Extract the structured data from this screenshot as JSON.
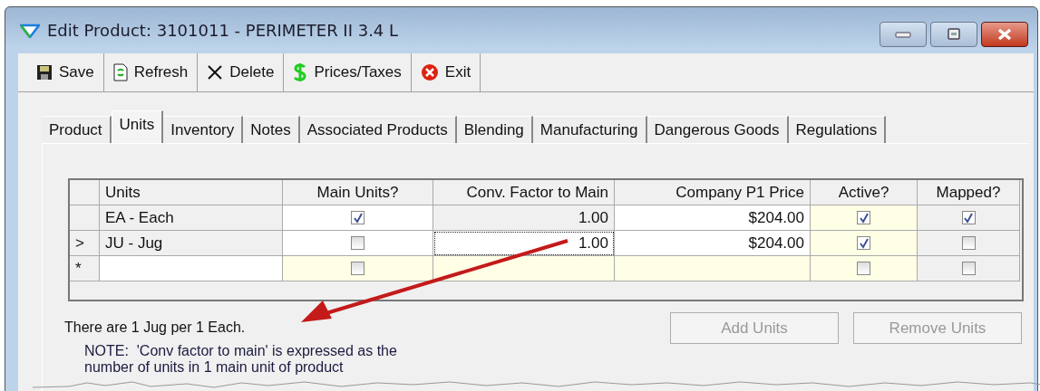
{
  "window": {
    "title": "Edit Product: 3101011 - PERIMETER II 3.4 L"
  },
  "toolbar": [
    {
      "kind": "save",
      "label": "Save"
    },
    {
      "kind": "refresh",
      "label": "Refresh"
    },
    {
      "kind": "delete",
      "label": "Delete"
    },
    {
      "kind": "prices",
      "label": "Prices/Taxes"
    },
    {
      "kind": "exit",
      "label": "Exit"
    }
  ],
  "tabs": [
    {
      "label": "Product",
      "selected": false
    },
    {
      "label": "Units",
      "selected": true
    },
    {
      "label": "Inventory",
      "selected": false
    },
    {
      "label": "Notes",
      "selected": false
    },
    {
      "label": "Associated Products",
      "selected": false
    },
    {
      "label": "Blending",
      "selected": false
    },
    {
      "label": "Manufacturing",
      "selected": false
    },
    {
      "label": "Dangerous Goods",
      "selected": false
    },
    {
      "label": "Regulations",
      "selected": false
    }
  ],
  "table": {
    "columns": [
      "Units",
      "Main Units?",
      "Conv. Factor to Main",
      "Company P1 Price",
      "Active?",
      "Mapped?"
    ],
    "rows": [
      {
        "kind": "data",
        "marker": "",
        "selected": false,
        "units": "EA - Each",
        "main_units": true,
        "conv_factor": "1.00",
        "price": "$204.00",
        "active": true,
        "mapped": true
      },
      {
        "kind": "data",
        "marker": ">",
        "selected": true,
        "units": "JU - Jug",
        "main_units": false,
        "conv_factor": "1.00",
        "price": "$204.00",
        "active": true,
        "mapped": false
      },
      {
        "kind": "new",
        "marker": "*",
        "selected": false,
        "main_units": false,
        "active": false,
        "mapped": false
      }
    ]
  },
  "summary": "There are 1 Jug per 1 Each.",
  "buttons": [
    {
      "label": "Add Units",
      "disabled": true
    },
    {
      "label": "Remove Units",
      "disabled": true
    }
  ],
  "note": "NOTE:  'Conv factor to main' is expressed as the number of units in 1 main unit of product"
}
